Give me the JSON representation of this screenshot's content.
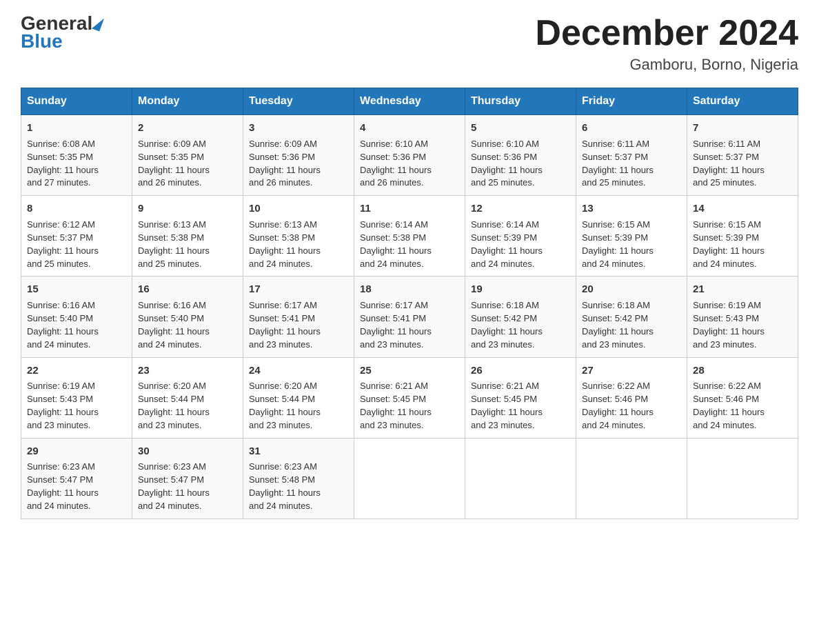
{
  "header": {
    "logo_general": "General",
    "logo_blue": "Blue",
    "month_title": "December 2024",
    "location": "Gamboru, Borno, Nigeria"
  },
  "days_of_week": [
    "Sunday",
    "Monday",
    "Tuesday",
    "Wednesday",
    "Thursday",
    "Friday",
    "Saturday"
  ],
  "weeks": [
    [
      {
        "day": "1",
        "sunrise": "6:08 AM",
        "sunset": "5:35 PM",
        "daylight": "11 hours and 27 minutes."
      },
      {
        "day": "2",
        "sunrise": "6:09 AM",
        "sunset": "5:35 PM",
        "daylight": "11 hours and 26 minutes."
      },
      {
        "day": "3",
        "sunrise": "6:09 AM",
        "sunset": "5:36 PM",
        "daylight": "11 hours and 26 minutes."
      },
      {
        "day": "4",
        "sunrise": "6:10 AM",
        "sunset": "5:36 PM",
        "daylight": "11 hours and 26 minutes."
      },
      {
        "day": "5",
        "sunrise": "6:10 AM",
        "sunset": "5:36 PM",
        "daylight": "11 hours and 25 minutes."
      },
      {
        "day": "6",
        "sunrise": "6:11 AM",
        "sunset": "5:37 PM",
        "daylight": "11 hours and 25 minutes."
      },
      {
        "day": "7",
        "sunrise": "6:11 AM",
        "sunset": "5:37 PM",
        "daylight": "11 hours and 25 minutes."
      }
    ],
    [
      {
        "day": "8",
        "sunrise": "6:12 AM",
        "sunset": "5:37 PM",
        "daylight": "11 hours and 25 minutes."
      },
      {
        "day": "9",
        "sunrise": "6:13 AM",
        "sunset": "5:38 PM",
        "daylight": "11 hours and 25 minutes."
      },
      {
        "day": "10",
        "sunrise": "6:13 AM",
        "sunset": "5:38 PM",
        "daylight": "11 hours and 24 minutes."
      },
      {
        "day": "11",
        "sunrise": "6:14 AM",
        "sunset": "5:38 PM",
        "daylight": "11 hours and 24 minutes."
      },
      {
        "day": "12",
        "sunrise": "6:14 AM",
        "sunset": "5:39 PM",
        "daylight": "11 hours and 24 minutes."
      },
      {
        "day": "13",
        "sunrise": "6:15 AM",
        "sunset": "5:39 PM",
        "daylight": "11 hours and 24 minutes."
      },
      {
        "day": "14",
        "sunrise": "6:15 AM",
        "sunset": "5:39 PM",
        "daylight": "11 hours and 24 minutes."
      }
    ],
    [
      {
        "day": "15",
        "sunrise": "6:16 AM",
        "sunset": "5:40 PM",
        "daylight": "11 hours and 24 minutes."
      },
      {
        "day": "16",
        "sunrise": "6:16 AM",
        "sunset": "5:40 PM",
        "daylight": "11 hours and 24 minutes."
      },
      {
        "day": "17",
        "sunrise": "6:17 AM",
        "sunset": "5:41 PM",
        "daylight": "11 hours and 23 minutes."
      },
      {
        "day": "18",
        "sunrise": "6:17 AM",
        "sunset": "5:41 PM",
        "daylight": "11 hours and 23 minutes."
      },
      {
        "day": "19",
        "sunrise": "6:18 AM",
        "sunset": "5:42 PM",
        "daylight": "11 hours and 23 minutes."
      },
      {
        "day": "20",
        "sunrise": "6:18 AM",
        "sunset": "5:42 PM",
        "daylight": "11 hours and 23 minutes."
      },
      {
        "day": "21",
        "sunrise": "6:19 AM",
        "sunset": "5:43 PM",
        "daylight": "11 hours and 23 minutes."
      }
    ],
    [
      {
        "day": "22",
        "sunrise": "6:19 AM",
        "sunset": "5:43 PM",
        "daylight": "11 hours and 23 minutes."
      },
      {
        "day": "23",
        "sunrise": "6:20 AM",
        "sunset": "5:44 PM",
        "daylight": "11 hours and 23 minutes."
      },
      {
        "day": "24",
        "sunrise": "6:20 AM",
        "sunset": "5:44 PM",
        "daylight": "11 hours and 23 minutes."
      },
      {
        "day": "25",
        "sunrise": "6:21 AM",
        "sunset": "5:45 PM",
        "daylight": "11 hours and 23 minutes."
      },
      {
        "day": "26",
        "sunrise": "6:21 AM",
        "sunset": "5:45 PM",
        "daylight": "11 hours and 23 minutes."
      },
      {
        "day": "27",
        "sunrise": "6:22 AM",
        "sunset": "5:46 PM",
        "daylight": "11 hours and 24 minutes."
      },
      {
        "day": "28",
        "sunrise": "6:22 AM",
        "sunset": "5:46 PM",
        "daylight": "11 hours and 24 minutes."
      }
    ],
    [
      {
        "day": "29",
        "sunrise": "6:23 AM",
        "sunset": "5:47 PM",
        "daylight": "11 hours and 24 minutes."
      },
      {
        "day": "30",
        "sunrise": "6:23 AM",
        "sunset": "5:47 PM",
        "daylight": "11 hours and 24 minutes."
      },
      {
        "day": "31",
        "sunrise": "6:23 AM",
        "sunset": "5:48 PM",
        "daylight": "11 hours and 24 minutes."
      },
      null,
      null,
      null,
      null
    ]
  ],
  "labels": {
    "sunrise": "Sunrise:",
    "sunset": "Sunset:",
    "daylight": "Daylight:"
  }
}
